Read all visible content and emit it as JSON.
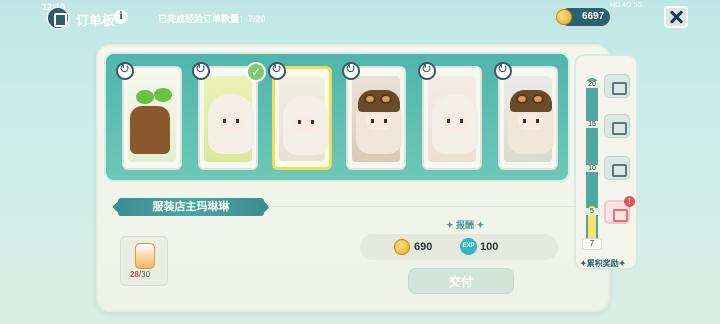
{
  "status": {
    "time": "12:10",
    "indicators": "HD 4G 5G"
  },
  "header": {
    "title": "订单板",
    "orders_label": "已完成经验订单数量：",
    "orders_value": "7/20"
  },
  "currency": {
    "coins": "6697"
  },
  "npc": {
    "name": "服装店主玛琳琳"
  },
  "bottle": {
    "current": "28",
    "total": "/30"
  },
  "reward": {
    "title": "报酬",
    "coins": "690",
    "exp_icon": "EXP",
    "exp": "100"
  },
  "deliver": {
    "label": "交付"
  },
  "side": {
    "ticks": [
      "20",
      "15",
      "10",
      "5"
    ],
    "current_level": "7",
    "label": "累积奖励",
    "alert": "!"
  },
  "icons": {
    "check": "✓",
    "info": "i"
  }
}
